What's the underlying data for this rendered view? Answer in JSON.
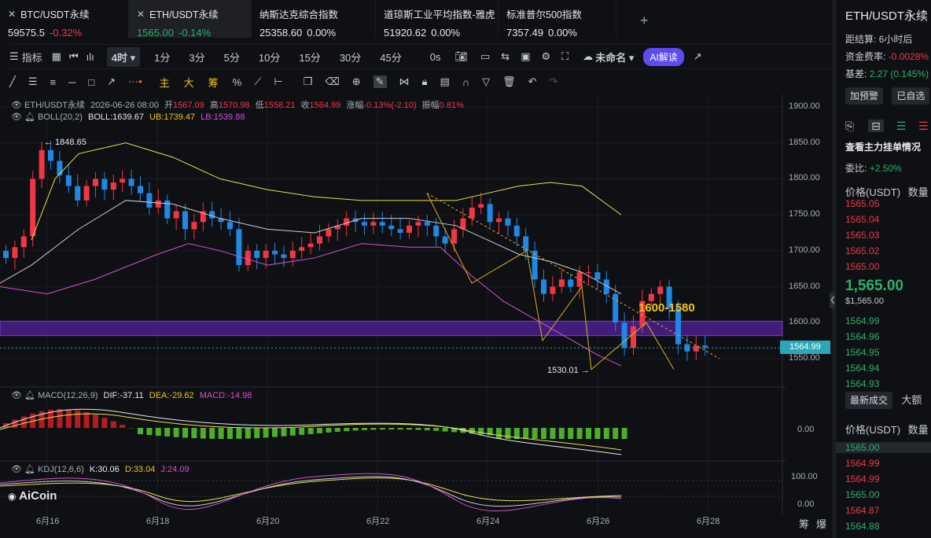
{
  "tabs": [
    {
      "symbol": "BTC/USDT永续",
      "price": "59575.5",
      "change": "-0.32%",
      "change_color": "#f23645"
    },
    {
      "symbol": "ETH/USDT永续",
      "price": "1565.00",
      "change": "-0.14%",
      "change_color": "#26b36a",
      "active": true
    },
    {
      "symbol": "纳斯达克综合指数",
      "price": "25358.60",
      "change": "0.00%"
    },
    {
      "symbol": "道琼斯工业平均指数-雅虎",
      "price": "51920.62",
      "change": "0.00%"
    },
    {
      "symbol": "标准普尔500指数",
      "price": "7357.49",
      "change": "0.00%"
    }
  ],
  "add_tab": "+",
  "toolbar": {
    "indicator": "指标",
    "interval": "4时",
    "intervals": [
      "1分",
      "3分",
      "5分",
      "10分",
      "15分",
      "30分",
      "45分"
    ],
    "zero_s": "0s",
    "layout_name": "未命名",
    "ai_button": "AI解读"
  },
  "drawing_tools": {
    "main": "主",
    "big": "大",
    "chip": "筹"
  },
  "legend": {
    "ohlc": {
      "symbol": "ETH/USDT永续",
      "date": "2026-06-26 08:00",
      "open_label": "开",
      "open": "1567.09",
      "high_label": "高",
      "high": "1570.98",
      "low_label": "低",
      "low": "1558.21",
      "close_label": "收",
      "close": "1564.99",
      "chg_label": "涨幅",
      "chg": "-0.13%(-2.10)",
      "amp_label": "振幅",
      "amp": "0.81%"
    },
    "boll": {
      "name": "BOLL(20,2)",
      "boll": "BOLL:1639.67",
      "ub": "UB:1739.47",
      "lb": "LB:1539.88"
    },
    "macd": {
      "name": "MACD(12,26,9)",
      "dif": "DIF:-37.11",
      "dea": "DEA:-29.62",
      "macd": "MACD:-14.98"
    },
    "kdj": {
      "name": "KDJ(12,6,6)",
      "k": "K:30.06",
      "d": "D:33.04",
      "j": "J:24.09"
    }
  },
  "price_axis": [
    "1900.00",
    "1850.00",
    "1800.00",
    "1750.00",
    "1700.00",
    "1650.00",
    "1600.00",
    "1550.00"
  ],
  "current_price_tag": "1564.99",
  "macd_axis": "0.00",
  "kdj_axis": [
    "100.00",
    "0.00"
  ],
  "x_labels": [
    "6月16",
    "6月18",
    "6月20",
    "6月22",
    "6月24",
    "6月26",
    "6月28"
  ],
  "annotations": {
    "high": "← 1848.65",
    "low": "1530.01 →",
    "zone": "1600-1580"
  },
  "logo": "AiCoin",
  "corner": [
    "筹",
    "爆"
  ],
  "sidebar": {
    "title": "ETH/USDT永续",
    "settle_label": "距结算:",
    "settle_value": "6小时后",
    "funding_label": "资金费率:",
    "funding_value": "-0.0028%",
    "basis_label": "基差:",
    "basis_value": "2.27 (0.145%)",
    "alert_button": "加预警",
    "watch_button": "已自选",
    "orderbook_title": "查看主力挂单情况",
    "ratio_label": "委比:",
    "ratio_value": "+2.50%",
    "price_header": "价格(USDT)",
    "qty_header": "数量",
    "asks": [
      "1565.05",
      "1565.04",
      "1565.03",
      "1565.02",
      "1565.00"
    ],
    "last_price": "1,565.00",
    "last_usd": "$1,565.00",
    "bids": [
      "1564.99",
      "1564.96",
      "1564.95",
      "1564.94",
      "1564.93"
    ],
    "trades_tab": "最新成交",
    "trades_tab2": "大额",
    "trades": [
      {
        "p": "1565.00",
        "c": "green"
      },
      {
        "p": "1564.99",
        "c": "red"
      },
      {
        "p": "1564.99",
        "c": "red"
      },
      {
        "p": "1565.00",
        "c": "green"
      },
      {
        "p": "1564.87",
        "c": "red"
      },
      {
        "p": "1564.88",
        "c": "green"
      }
    ]
  }
}
